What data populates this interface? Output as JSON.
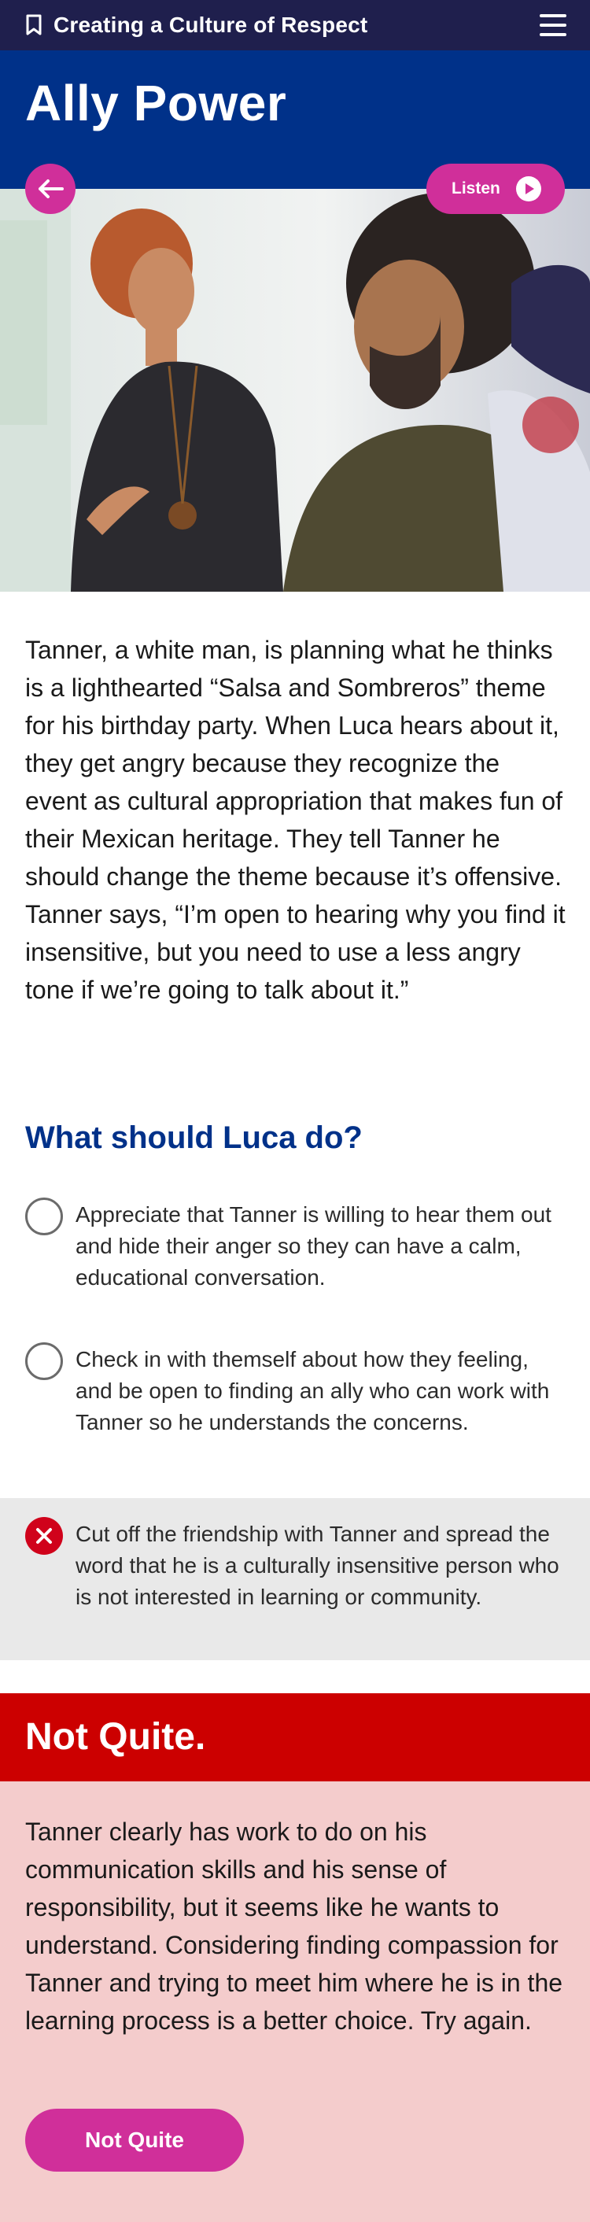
{
  "topbar": {
    "title": "Creating a Culture of Respect",
    "bookmark_icon": "bookmark-icon",
    "menu_icon": "hamburger-menu-icon"
  },
  "header": {
    "title": "Ally Power"
  },
  "controls": {
    "back_icon": "arrow-left-icon",
    "listen_label": "Listen",
    "listen_icon": "play-circle-icon"
  },
  "photo": {
    "description": "two people talking on a couch"
  },
  "scenario": {
    "text": "Tanner, a white man, is planning what he thinks is a lighthearted “Salsa and Sombreros” theme for his birthday party. When Luca hears about it, they get angry because they recognize the event as cultural appropriation that makes fun of their Mexican heritage. They tell Tanner he should change the theme because it’s offensive. Tanner says, “I’m open to hearing why you find it insensitive, but you need to use a less angry tone if we’re going to talk about it.”"
  },
  "question": {
    "title": "What should Luca do?",
    "options": [
      {
        "label": "Appreciate that Tanner is willing to hear them out and hide their anger so they can have a calm, educational conversation.",
        "state": "unselected"
      },
      {
        "label": "Check in with themself about how they feeling, and be open to finding an ally who can work with Tanner so he understands the concerns.",
        "state": "unselected"
      },
      {
        "label": "Cut off the friendship with Tanner and spread the word that he is a culturally insensitive person who is not interested in learning or community.",
        "state": "selected-incorrect"
      }
    ]
  },
  "feedback": {
    "title": "Not Quite.",
    "text": "Tanner clearly has work to do on his communication skills and his sense of responsibility, but it seems like he wants to understand. Considering finding compassion for Tanner and trying to meet him where he is in the learning process is a better choice. Try again.",
    "button_label": "Not Quite"
  },
  "colors": {
    "topbar": "#1f1f4d",
    "header": "#003189",
    "accent": "#d02f9a",
    "incorrect": "#cc0000",
    "feedback_bg": "#f4cccc",
    "selected_row_bg": "#e9e9e9"
  }
}
